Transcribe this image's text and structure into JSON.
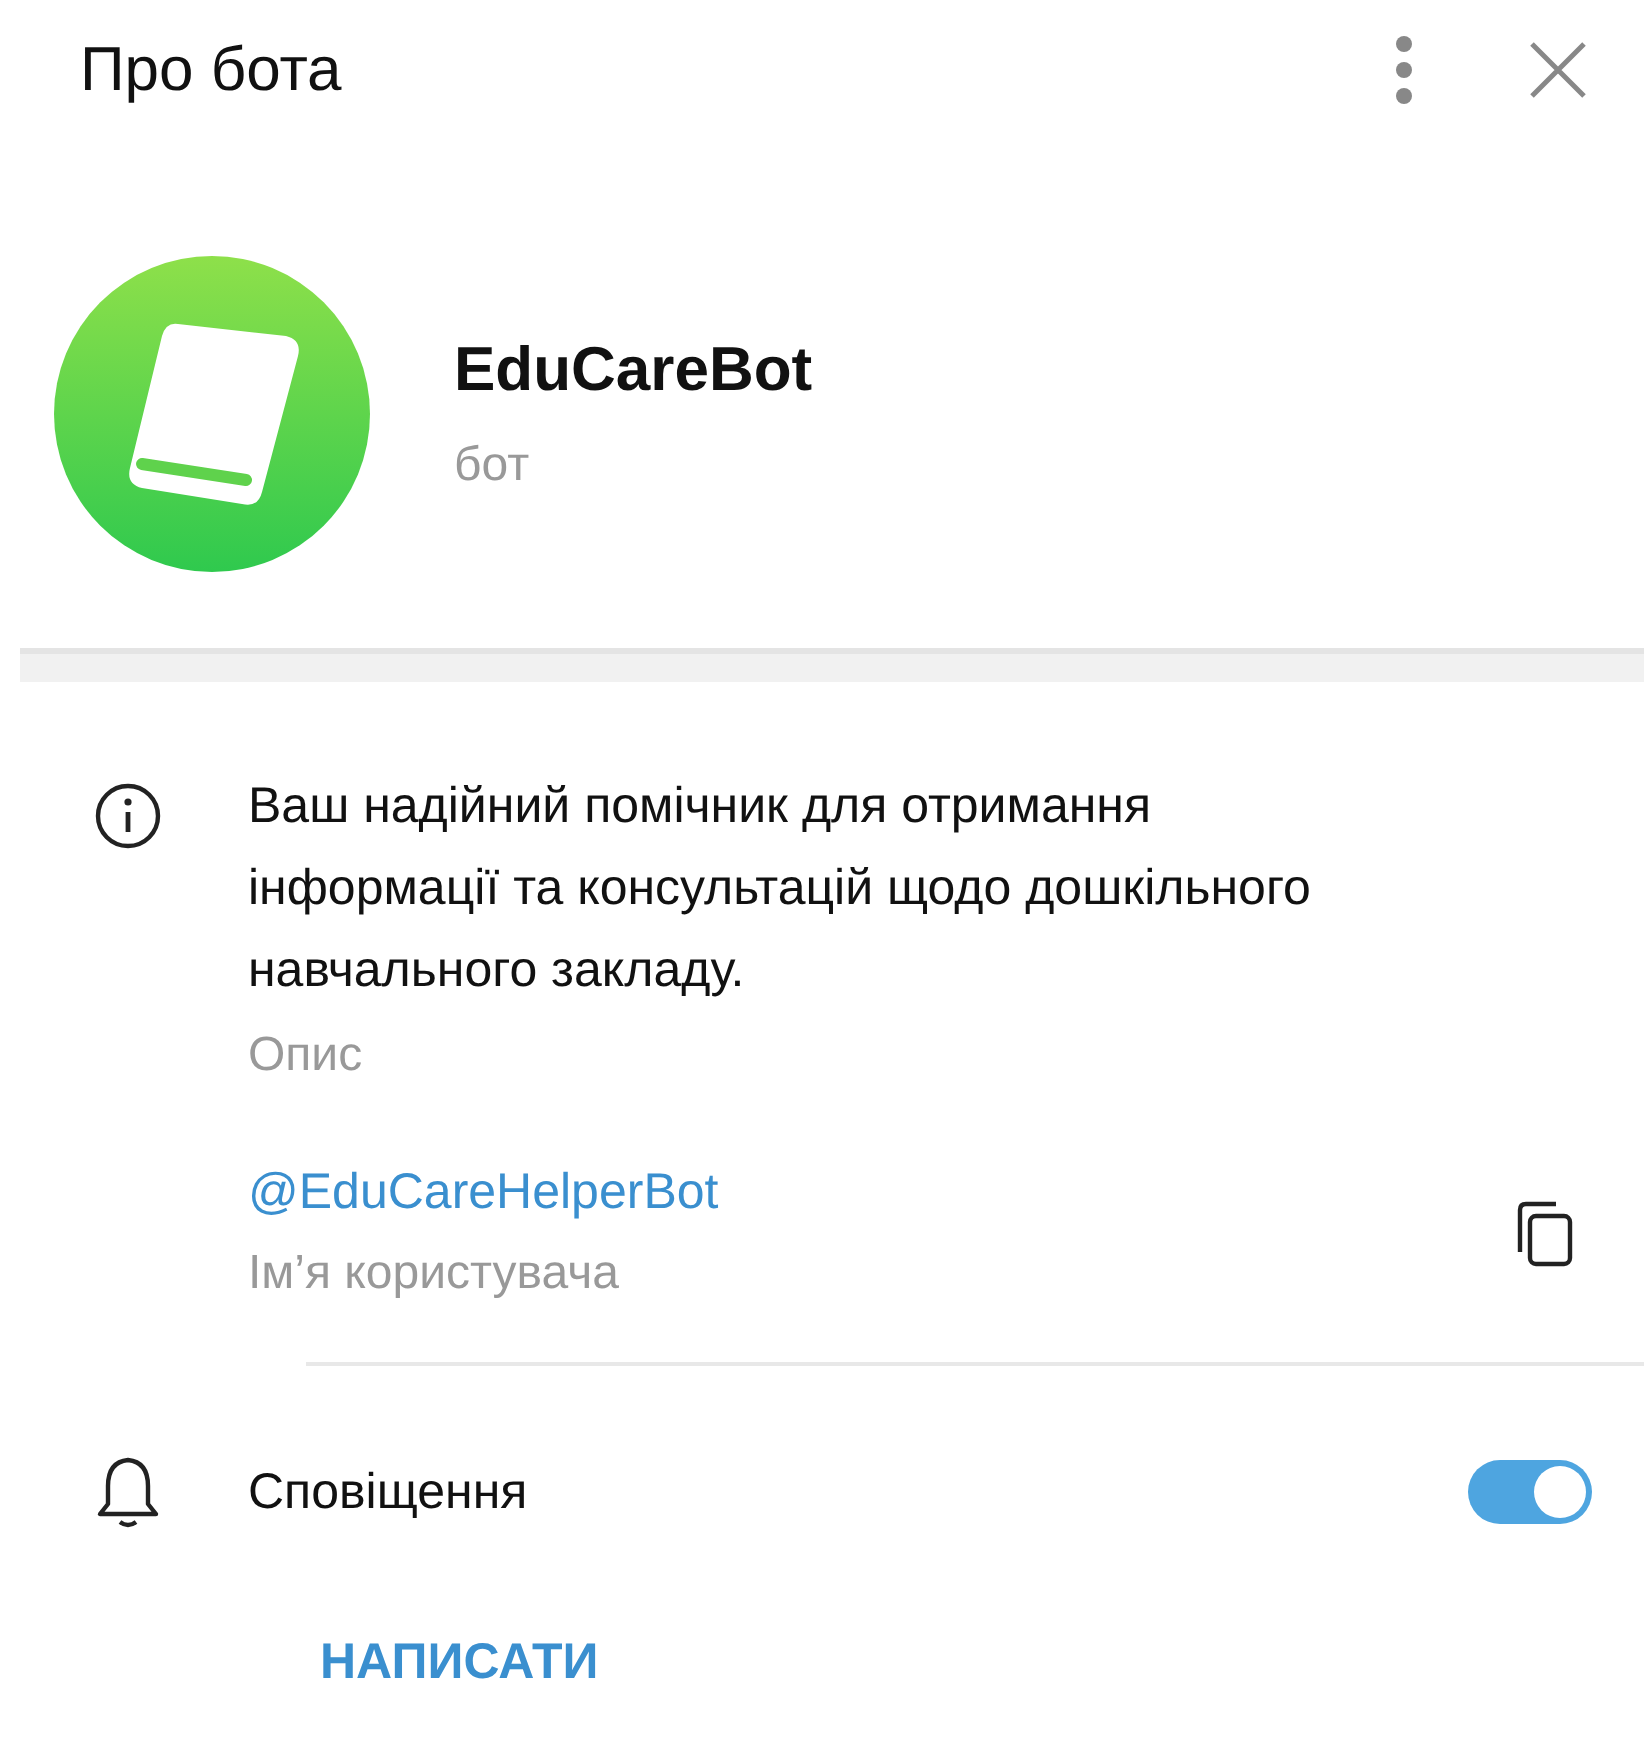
{
  "header": {
    "title": "Про бота"
  },
  "bot": {
    "name": "EduCareBot",
    "subtitle": "бот"
  },
  "description": {
    "text": "Ваш надійний помічник для отримання інформації та консультацій щодо дошкільного навчального закладу.",
    "label": "Опис"
  },
  "username": {
    "value": "@EduCareHelperBot",
    "label": "Ім’я користувача"
  },
  "notifications": {
    "label": "Сповіщення",
    "on": true
  },
  "action": {
    "label": "НАПИСАТИ"
  }
}
